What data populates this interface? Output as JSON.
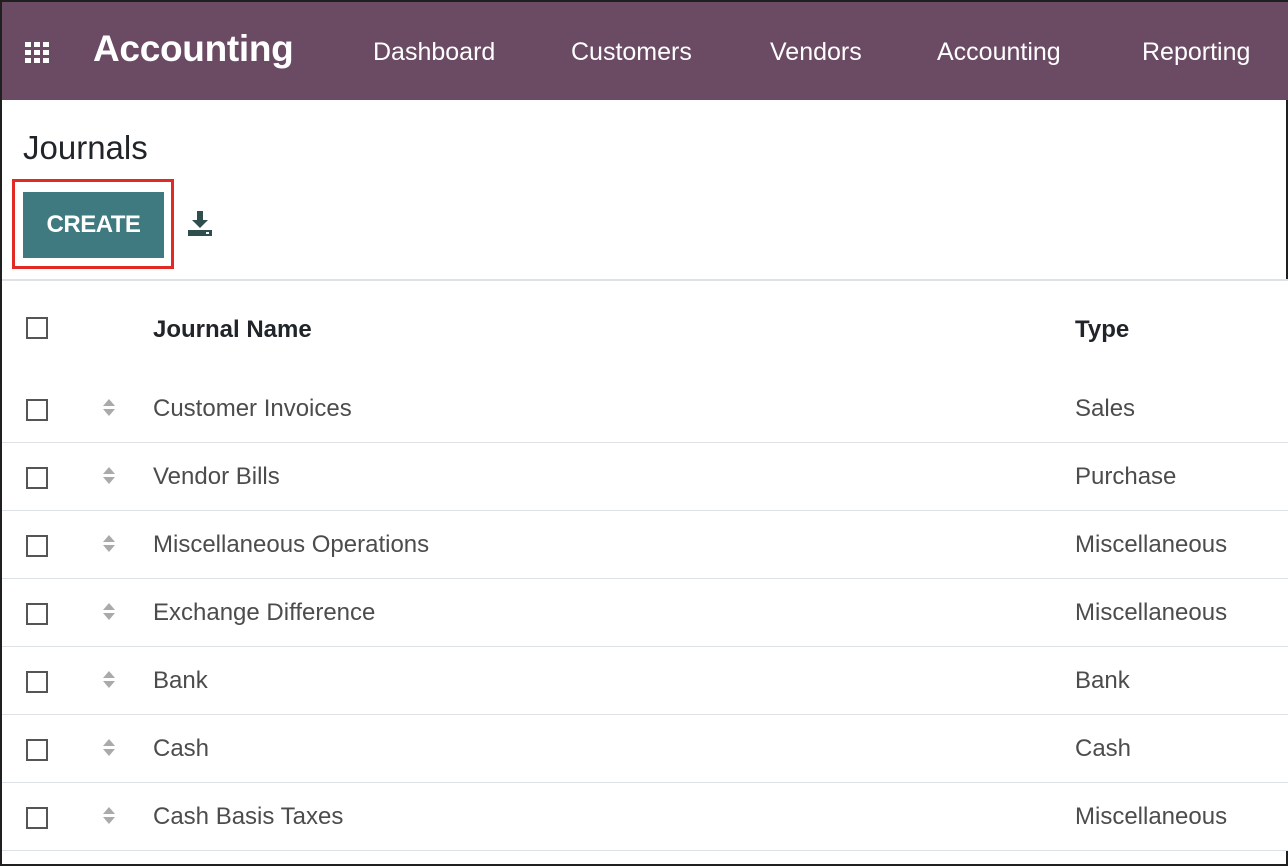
{
  "topbar": {
    "app_title": "Accounting",
    "menu": [
      "Dashboard",
      "Customers",
      "Vendors",
      "Accounting",
      "Reporting"
    ],
    "apps_icon": "grid-icon"
  },
  "page": {
    "title": "Journals",
    "create_label": "CREATE",
    "download_icon": "download-icon"
  },
  "table": {
    "columns": [
      "Journal Name",
      "Type"
    ],
    "rows": [
      {
        "name": "Customer Invoices",
        "type": "Sales"
      },
      {
        "name": "Vendor Bills",
        "type": "Purchase"
      },
      {
        "name": "Miscellaneous Operations",
        "type": "Miscellaneous"
      },
      {
        "name": "Exchange Difference",
        "type": "Miscellaneous"
      },
      {
        "name": "Bank",
        "type": "Bank"
      },
      {
        "name": "Cash",
        "type": "Cash"
      },
      {
        "name": "Cash Basis Taxes",
        "type": "Miscellaneous"
      }
    ]
  },
  "colors": {
    "topbar": "#6b4a64",
    "create_button": "#3e7a80",
    "highlight": "#e02a23"
  }
}
